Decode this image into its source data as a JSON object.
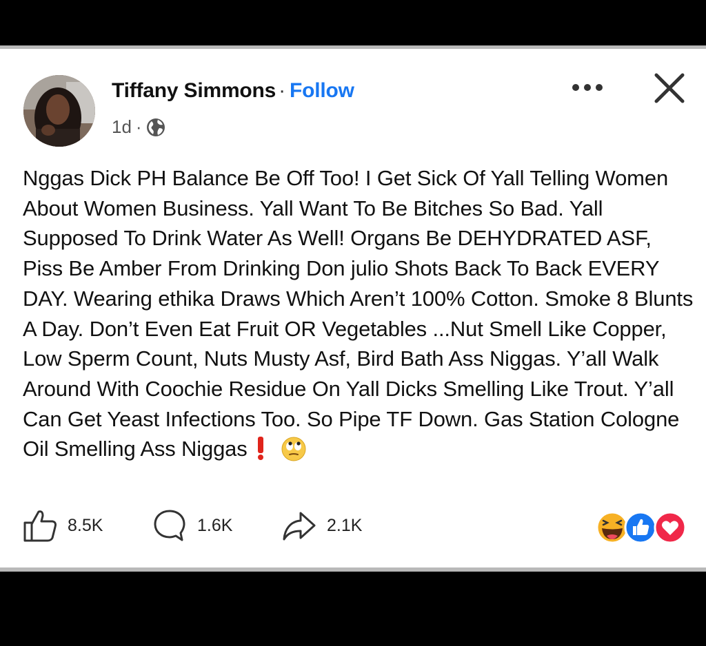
{
  "post": {
    "author": "Tiffany Simmons",
    "separator": "·",
    "follow_label": "Follow",
    "timestamp": "1d",
    "meta_separator": "·",
    "privacy_icon": "globe-icon",
    "text": "Nggas Dick PH Balance Be Off Too! I Get Sick Of Yall Telling Women About Women Business. Yall Want To Be Bitches So Bad. Yall Supposed To Drink Water As Well! Organs Be DEHYDRATED ASF, Piss Be Amber From Drinking Don julio Shots Back To Back EVERY DAY. Wearing ethika Draws Which Aren’t 100% Cotton. Smoke 8 Blunts A Day. Don’t Even Eat Fruit OR Vegetables ...Nut Smell Like Copper, Low Sperm Count, Nuts Musty Asf, Bird Bath Ass Niggas. Y’all Walk Around With Coochie Residue On Yall Dicks Smelling Like Trout. Y’all Can Get Yeast Infections Too. So Pipe TF Down. Gas Station Cologne Oil Smelling Ass Niggas"
  },
  "actions": {
    "likes": "8.5K",
    "comments": "1.6K",
    "shares": "2.1K"
  },
  "icons": {
    "more": "more-options-icon",
    "close": "close-icon",
    "emoji_trail": [
      "red-exclamation-icon",
      "eye-roll-emoji-icon"
    ],
    "reactions": [
      "haha-reaction-icon",
      "like-reaction-icon",
      "love-reaction-icon"
    ]
  },
  "colors": {
    "follow": "#1877f2",
    "like_reaction": "#1877f2",
    "love_reaction": "#f02849",
    "haha_reaction": "#f7b125"
  }
}
